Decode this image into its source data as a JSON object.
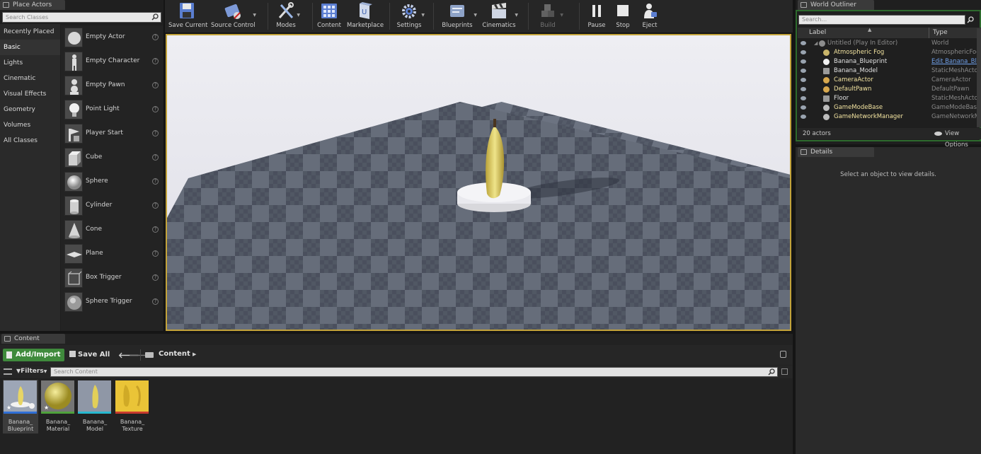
{
  "place_actors": {
    "tab_title": "Place Actors",
    "search_placeholder": "Search Classes",
    "categories": [
      "Recently Placed",
      "Basic",
      "Lights",
      "Cinematic",
      "Visual Effects",
      "Geometry",
      "Volumes",
      "All Classes"
    ],
    "active_category": "Basic",
    "actors": [
      "Empty Actor",
      "Empty Character",
      "Empty Pawn",
      "Point Light",
      "Player Start",
      "Cube",
      "Sphere",
      "Cylinder",
      "Cone",
      "Plane",
      "Box Trigger",
      "Sphere Trigger"
    ],
    "help_glyph": "?"
  },
  "toolbar": {
    "save_current": "Save Current",
    "source_control": "Source Control",
    "modes": "Modes",
    "content": "Content",
    "marketplace": "Marketplace",
    "settings": "Settings",
    "blueprints": "Blueprints",
    "cinematics": "Cinematics",
    "build": "Build",
    "pause": "Pause",
    "stop": "Stop",
    "eject": "Eject"
  },
  "outliner": {
    "tab_title": "World Outliner",
    "search_placeholder": "Search...",
    "col_label": "Label",
    "col_type": "Type",
    "rows": [
      {
        "label": "Untitled (Play In Editor)",
        "type": "World"
      },
      {
        "label": "Atmospheric Fog",
        "type": "AtmosphericFog"
      },
      {
        "label": "Banana_Blueprint",
        "type": "Edit Banana_Blue"
      },
      {
        "label": "Banana_Model",
        "type": "StaticMeshActor"
      },
      {
        "label": "CameraActor",
        "type": "CameraActor"
      },
      {
        "label": "DefaultPawn",
        "type": "DefaultPawn"
      },
      {
        "label": "Floor",
        "type": "StaticMeshActor"
      },
      {
        "label": "GameModeBase",
        "type": "GameModeBase"
      },
      {
        "label": "GameNetworkManager",
        "type": "GameNetworkMan"
      }
    ],
    "actor_count": "20 actors",
    "view_options": "View Options"
  },
  "details": {
    "tab_title": "Details",
    "empty_message": "Select an object to view details."
  },
  "content_browser": {
    "tab_title": "Content Browser",
    "add_import": "Add/Import",
    "save_all": "Save All",
    "path_root": "Content",
    "filters": "Filters",
    "search_placeholder": "Search Content",
    "assets": [
      {
        "name": "Banana_ Blueprint",
        "bar_color": "#2f6fd6"
      },
      {
        "name": "Banana_ Material",
        "bar_color": "#4fa23c"
      },
      {
        "name": "Banana_ Model",
        "bar_color": "#27b8d0"
      },
      {
        "name": "Banana_ Texture",
        "bar_color": "#c83a2e"
      }
    ]
  },
  "colors": {
    "viewport_border": "#c3a33a",
    "outliner_border": "#2d6a2d",
    "add_button": "#3f8a3c",
    "highlight_text": "#f2e3a0"
  }
}
